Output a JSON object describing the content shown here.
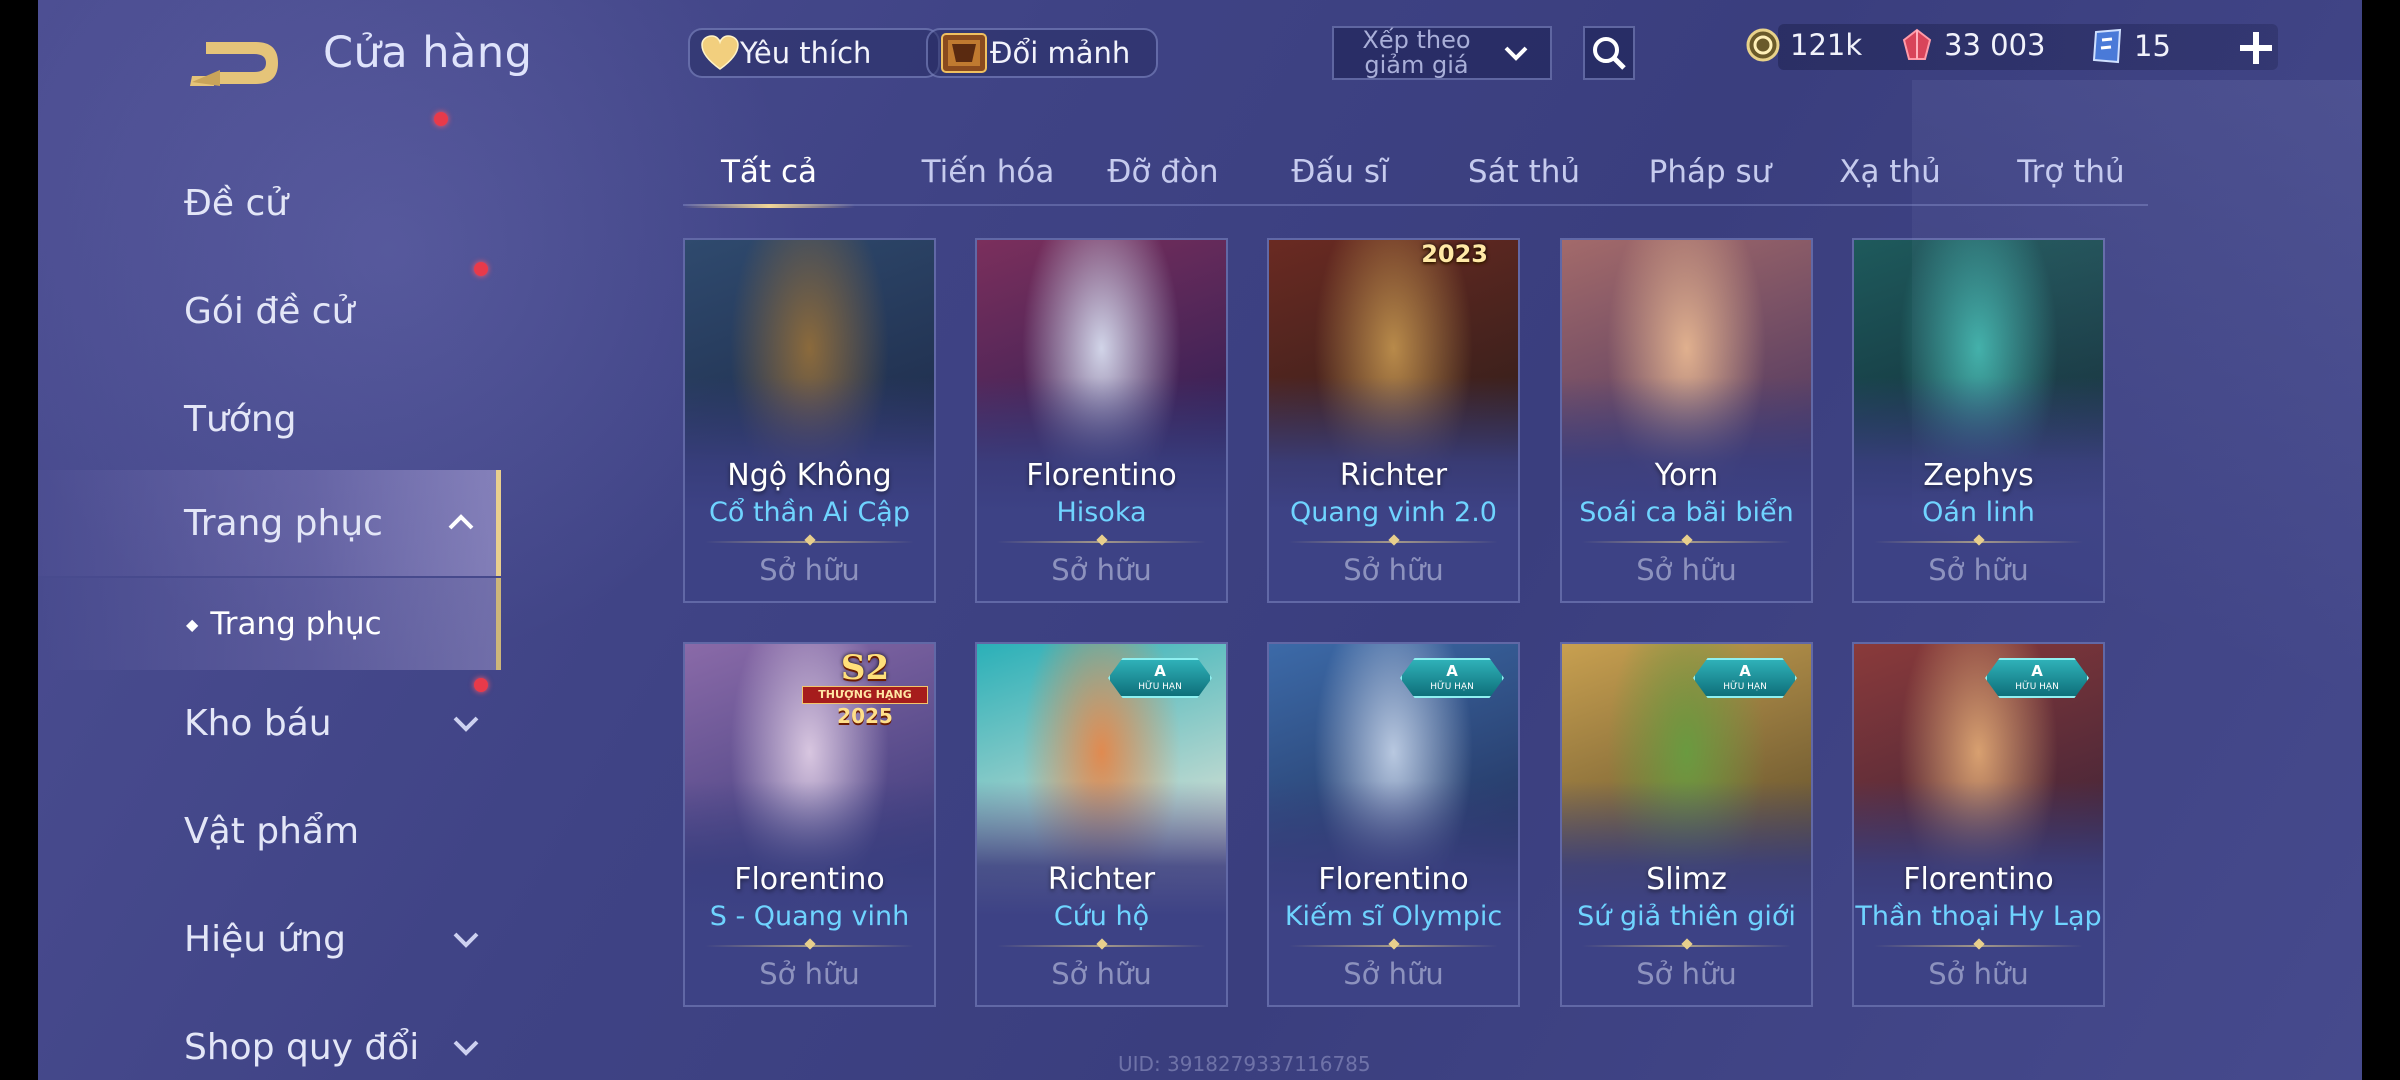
{
  "header": {
    "title": "Cửa hàng",
    "favorites_label": "Yêu thích",
    "exchange_label": "Đổi mảnh",
    "sort_label": "Xếp theo giảm giá",
    "currencies": [
      {
        "icon": "gold-coin-icon",
        "value": "121k"
      },
      {
        "icon": "red-gem-icon",
        "value": "33 003"
      },
      {
        "icon": "blue-voucher-icon",
        "value": "15"
      }
    ]
  },
  "sidebar": {
    "items": [
      {
        "label": "Đề cử",
        "badge": false
      },
      {
        "label": "Gói đề cử",
        "badge": true
      },
      {
        "label": "Tướng",
        "badge": false
      },
      {
        "label": "Trang phục",
        "badge": false,
        "expanded": true
      },
      {
        "label": "Kho báu",
        "badge": true
      },
      {
        "label": "Vật phẩm",
        "badge": false
      },
      {
        "label": "Hiệu ứng",
        "badge": false
      },
      {
        "label": "Shop quy đổi",
        "badge": false
      }
    ],
    "sub_item": "Trang phục"
  },
  "tabs": [
    "Tất cả",
    "Tiến hóa",
    "Đỡ đòn",
    "Đấu sĩ",
    "Sát thủ",
    "Pháp sư",
    "Xạ thủ",
    "Trợ thủ"
  ],
  "active_tab": "Tất cả",
  "cards": [
    {
      "hero": "Ngộ Không",
      "skin": "Cổ thần Ai Cập",
      "status": "Sở hữu",
      "colors": [
        "#2f4a6e",
        "#8b6a3c",
        "#1d2a48"
      ]
    },
    {
      "hero": "Florentino",
      "skin": "Hisoka",
      "status": "Sở hữu",
      "colors": [
        "#7b2f5c",
        "#d1d4e8",
        "#2a1e55"
      ]
    },
    {
      "hero": "Richter",
      "skin": "Quang vinh 2.0",
      "status": "Sở hữu",
      "badge_text": "2023",
      "colors": [
        "#6a2a22",
        "#b88a4a",
        "#2c1d1a"
      ]
    },
    {
      "hero": "Yorn",
      "skin": "Soái ca bãi biển",
      "status": "Sở hữu",
      "colors": [
        "#a36a6a",
        "#e0b08e",
        "#4a3560"
      ]
    },
    {
      "hero": "Zephys",
      "skin": "Oán linh",
      "status": "Sở hữu",
      "colors": [
        "#1e5a5c",
        "#3fb0a8",
        "#122a36"
      ]
    },
    {
      "hero": "Florentino",
      "skin": "S - Quang vinh",
      "status": "Sở hữu",
      "badge_s2": {
        "big": "S2",
        "ribbon": "THƯỢNG HẠNG",
        "year": "2025"
      },
      "colors": [
        "#8a6aa8",
        "#d8c6e0",
        "#3a3a7a"
      ]
    },
    {
      "hero": "Richter",
      "skin": "Cứu hộ",
      "status": "Sở hữu",
      "badge_a": {
        "rank": "A",
        "note": "HỮU HẠN"
      },
      "colors": [
        "#2ab0b8",
        "#e08a50",
        "#f0e6d8"
      ]
    },
    {
      "hero": "Florentino",
      "skin": "Kiếm sĩ Olympic",
      "status": "Sở hữu",
      "badge_a": {
        "rank": "A",
        "note": "HỮU HẠN"
      },
      "colors": [
        "#3c6aa8",
        "#b8c8e0",
        "#22305a"
      ]
    },
    {
      "hero": "Slimz",
      "skin": "Sứ giả thiên giới",
      "status": "Sở hữu",
      "badge_a": {
        "rank": "A",
        "note": "HỮU HẠN"
      },
      "colors": [
        "#c8a050",
        "#6a9a40",
        "#5a4a2a"
      ]
    },
    {
      "hero": "Florentino",
      "skin": "Thần thoại Hy Lạp",
      "status": "Sở hữu",
      "badge_a": {
        "rank": "A",
        "note": "HỮU HẠN"
      },
      "colors": [
        "#8a3a3a",
        "#d8a070",
        "#3a2238"
      ]
    }
  ],
  "uid": "UID: 3918279337116785",
  "accent_gold": "#e9cf8e",
  "skin_name_color": "#6fd4ff"
}
